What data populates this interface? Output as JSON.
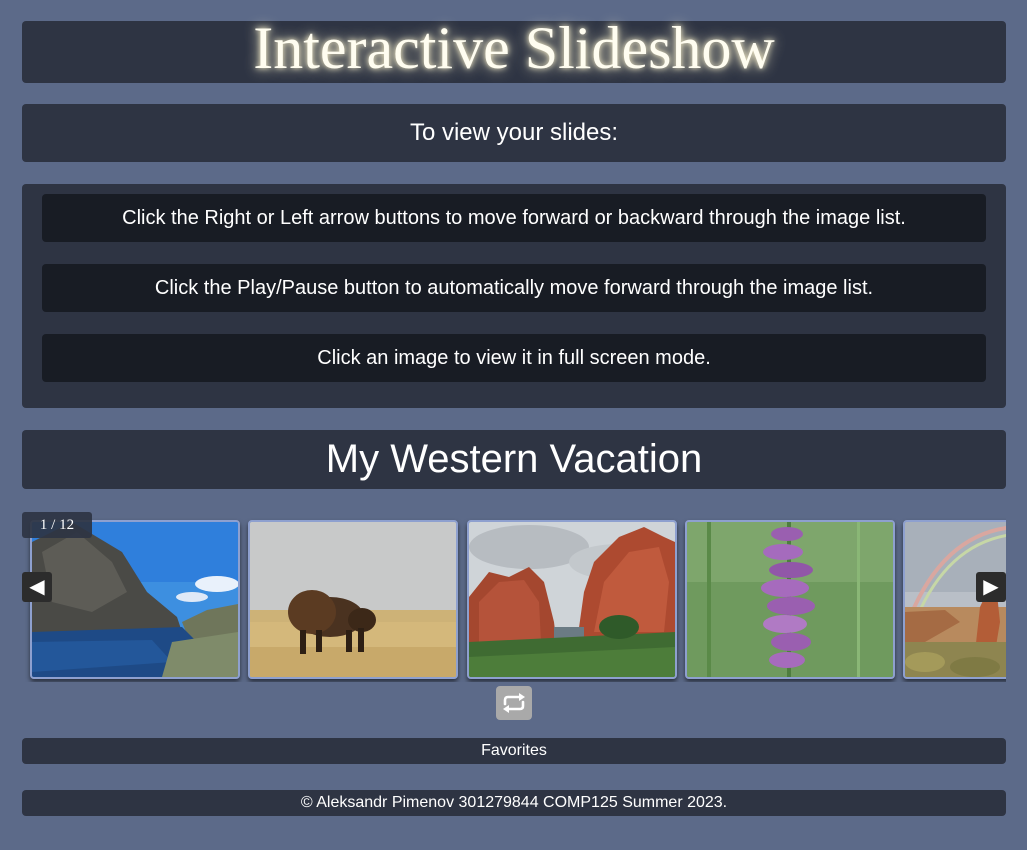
{
  "header": {
    "title": "Interactive Slideshow"
  },
  "subtitle": "To view your slides:",
  "instructions": [
    "Click the Right or Left arrow buttons to move forward or backward through the image list.",
    "Click the Play/Pause button to automatically move forward through the image list.",
    "Click an image to view it in full screen mode."
  ],
  "gallery": {
    "title": "My Western Vacation",
    "counter": "1 / 12",
    "prev_icon": "◀",
    "next_icon": "▶",
    "play_icon": "repeat-icon",
    "slides": [
      {
        "subject": "mountain lake"
      },
      {
        "subject": "bison on prairie"
      },
      {
        "subject": "red rock formations"
      },
      {
        "subject": "purple wildflower"
      },
      {
        "subject": "canyon with rainbow"
      }
    ]
  },
  "favorites": {
    "label": "Favorites"
  },
  "footer": {
    "text": "© Aleksandr Pimenov 301279844 COMP125 Summer 2023."
  },
  "colors": {
    "background": "#5c6a89",
    "panel": "#2e3443",
    "instruction_box": "#181c24",
    "slide_border": "#8ea0cf",
    "play_button": "#a9a9a9"
  }
}
